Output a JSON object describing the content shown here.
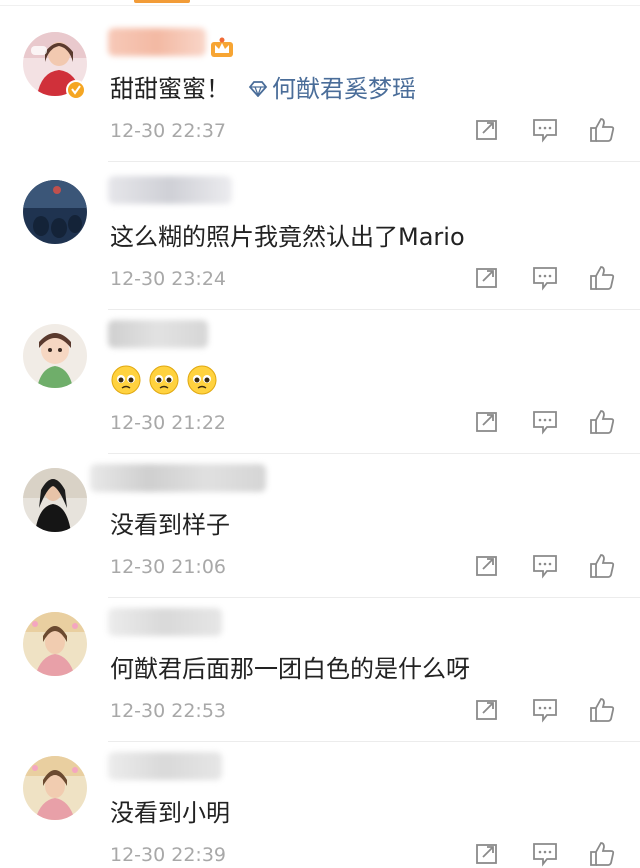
{
  "colors": {
    "accent_tab": "#f29c38",
    "topic_link": "#4a6d99",
    "timestamp": "#a8a8a8",
    "icon": "#8a8a8a",
    "divider": "#ececec"
  },
  "comments": [
    {
      "username": "",
      "username_blurred": true,
      "has_crown_badge": true,
      "verified": true,
      "text": "甜甜蜜蜜！",
      "topic_link": "何猷君奚梦瑶",
      "time": "12-30 22:37"
    },
    {
      "username": "",
      "username_blurred": true,
      "text": "这么糊的照片我竟然认出了Mario",
      "time": "12-30 23:24"
    },
    {
      "username": "",
      "username_blurred": true,
      "emojis": [
        "pleading-face-emoji",
        "pleading-face-emoji",
        "pleading-face-emoji"
      ],
      "time": "12-30 21:22"
    },
    {
      "username": "",
      "username_blurred": true,
      "text": "没看到样子",
      "time": "12-30 21:06"
    },
    {
      "username": "",
      "username_blurred": true,
      "text": "何猷君后面那一团白色的是什么呀",
      "time": "12-30 22:53"
    },
    {
      "username": "",
      "username_blurred": true,
      "text": "没看到小明",
      "time": "12-30 22:39"
    }
  ],
  "icons": {
    "repost": "repost-icon",
    "comment": "comment-icon",
    "like": "thumbs-up-icon",
    "topic": "diamond-topic-icon",
    "crown": "crown-badge-icon",
    "verified": "verified-badge-icon"
  }
}
